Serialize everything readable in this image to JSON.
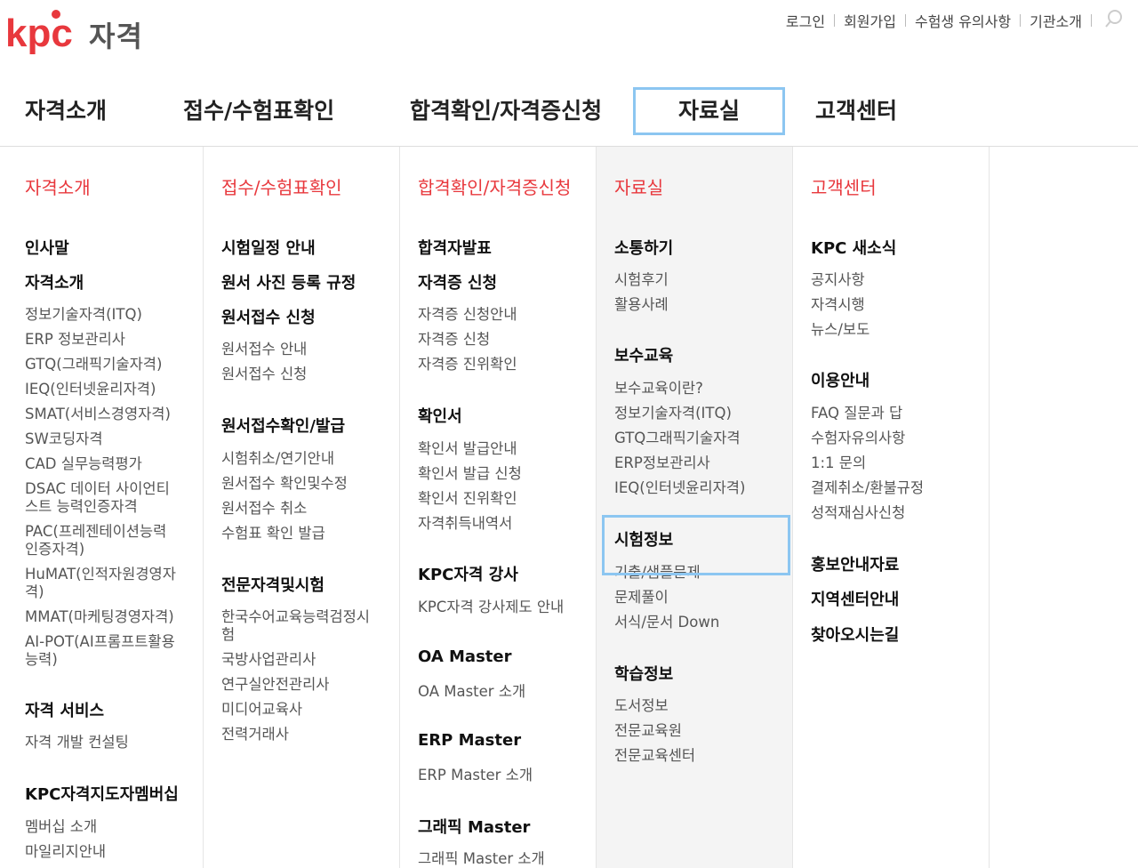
{
  "brand": {
    "logo_text": "kpc",
    "suffix": "자격",
    "logo_color": "#e8383d"
  },
  "util": [
    "로그인",
    "회원가입",
    "수험생 유의사항",
    "기관소개"
  ],
  "gnb": [
    "자격소개",
    "접수/수험표확인",
    "합격확인/자격증신청",
    "자료실",
    "고객센터"
  ],
  "accent": "#e8383d",
  "highlight_color": "#8cc6f1",
  "columns": [
    {
      "title": "자격소개",
      "items": [
        {
          "t": "h",
          "text": "인사말"
        },
        {
          "t": "h",
          "text": "자격소개"
        },
        {
          "t": "s",
          "text": "정보기술자격(ITQ)"
        },
        {
          "t": "s",
          "text": "ERP 정보관리사"
        },
        {
          "t": "s",
          "text": "GTQ(그래픽기술자격)"
        },
        {
          "t": "s",
          "text": "IEQ(인터넷윤리자격)"
        },
        {
          "t": "s",
          "text": "SMAT(서비스경영자격)"
        },
        {
          "t": "s",
          "text": "SW코딩자격"
        },
        {
          "t": "s",
          "text": "CAD 실무능력평가"
        },
        {
          "t": "s",
          "text": "DSAC 데이터 사이언티"
        },
        {
          "t": "s",
          "text": "스트 능력인증자격"
        },
        {
          "t": "s",
          "text": "PAC(프레젠테이션능력"
        },
        {
          "t": "s",
          "text": "인증자격)"
        },
        {
          "t": "s",
          "text": "HuMAT(인적자원경영자"
        },
        {
          "t": "s",
          "text": "격)"
        },
        {
          "t": "s",
          "text": "MMAT(마케팅경영자격)"
        },
        {
          "t": "s",
          "text": "AI-POT(AI프롬프트활용"
        },
        {
          "t": "s",
          "text": "능력)"
        },
        {
          "t": "h",
          "text": "자격 서비스"
        },
        {
          "t": "s",
          "text": "자격 개발 컨설팅"
        },
        {
          "t": "h",
          "text": "KPC자격지도자멤버십"
        },
        {
          "t": "s",
          "text": "멤버십 소개"
        },
        {
          "t": "s",
          "text": "마일리지안내"
        }
      ]
    },
    {
      "title": "접수/수험표확인",
      "items": [
        {
          "t": "h",
          "text": "시험일정 안내"
        },
        {
          "t": "h",
          "text": "원서 사진 등록 규정"
        },
        {
          "t": "h",
          "text": "원서접수 신청"
        },
        {
          "t": "s",
          "text": "원서접수 안내"
        },
        {
          "t": "s",
          "text": "원서접수 신청"
        },
        {
          "t": "h",
          "text": "원서접수확인/발급"
        },
        {
          "t": "s",
          "text": "시험취소/연기안내"
        },
        {
          "t": "s",
          "text": "원서접수 확인및수정"
        },
        {
          "t": "s",
          "text": "원서접수 취소"
        },
        {
          "t": "s",
          "text": "수험표 확인 발급"
        },
        {
          "t": "h",
          "text": "전문자격및시험"
        },
        {
          "t": "s",
          "text": "한국수어교육능력검정시"
        },
        {
          "t": "s",
          "text": "험"
        },
        {
          "t": "s",
          "text": "국방사업관리사"
        },
        {
          "t": "s",
          "text": "연구실안전관리사"
        },
        {
          "t": "s",
          "text": "미디어교육사"
        },
        {
          "t": "s",
          "text": "전력거래사"
        }
      ]
    },
    {
      "title": "합격확인/자격증신청",
      "items": [
        {
          "t": "h",
          "text": "합격자발표"
        },
        {
          "t": "h",
          "text": "자격증 신청"
        },
        {
          "t": "s",
          "text": "자격증 신청안내"
        },
        {
          "t": "s",
          "text": "자격증 신청"
        },
        {
          "t": "s",
          "text": "자격증 진위확인"
        },
        {
          "t": "h",
          "text": "확인서"
        },
        {
          "t": "s",
          "text": "확인서 발급안내"
        },
        {
          "t": "s",
          "text": "확인서 발급 신청"
        },
        {
          "t": "s",
          "text": "확인서 진위확인"
        },
        {
          "t": "s",
          "text": "자격취득내역서"
        },
        {
          "t": "h",
          "text": "KPC자격 강사"
        },
        {
          "t": "s",
          "text": "KPC자격 강사제도 안내"
        },
        {
          "t": "h",
          "text": "OA Master"
        },
        {
          "t": "s",
          "text": "OA Master 소개"
        },
        {
          "t": "h",
          "text": "ERP Master"
        },
        {
          "t": "s",
          "text": "ERP Master 소개"
        },
        {
          "t": "h",
          "text": "그래픽 Master"
        },
        {
          "t": "s",
          "text": "그래픽 Master 소개"
        }
      ]
    },
    {
      "title": "자료실",
      "items": [
        {
          "t": "h",
          "text": "소통하기"
        },
        {
          "t": "s",
          "text": "시험후기"
        },
        {
          "t": "s",
          "text": "활용사례"
        },
        {
          "t": "h",
          "text": "보수교육"
        },
        {
          "t": "s",
          "text": "보수교육이란?"
        },
        {
          "t": "s",
          "text": "정보기술자격(ITQ)"
        },
        {
          "t": "s",
          "text": "GTQ그래픽기술자격"
        },
        {
          "t": "s",
          "text": "ERP정보관리사"
        },
        {
          "t": "s",
          "text": "IEQ(인터넷윤리자격)"
        },
        {
          "t": "h",
          "text": "시험정보"
        },
        {
          "t": "s",
          "text": "기출/샘플문제"
        },
        {
          "t": "s",
          "text": "문제풀이"
        },
        {
          "t": "s",
          "text": "서식/문서 Down"
        },
        {
          "t": "h",
          "text": "학습정보"
        },
        {
          "t": "s",
          "text": "도서정보"
        },
        {
          "t": "s",
          "text": "전문교육원"
        },
        {
          "t": "s",
          "text": "전문교육센터"
        }
      ]
    },
    {
      "title": "고객센터",
      "items": [
        {
          "t": "h",
          "text": "KPC 새소식"
        },
        {
          "t": "s",
          "text": "공지사항"
        },
        {
          "t": "s",
          "text": "자격시행"
        },
        {
          "t": "s",
          "text": "뉴스/보도"
        },
        {
          "t": "h",
          "text": "이용안내"
        },
        {
          "t": "s",
          "text": "FAQ 질문과 답"
        },
        {
          "t": "s",
          "text": "수험자유의사항"
        },
        {
          "t": "s",
          "text": "1:1 문의"
        },
        {
          "t": "s",
          "text": "결제취소/환불규정"
        },
        {
          "t": "s",
          "text": "성적재심사신청"
        },
        {
          "t": "h",
          "text": "홍보안내자료"
        },
        {
          "t": "h",
          "text": "지역센터안내"
        },
        {
          "t": "h",
          "text": "찾아오시는길"
        }
      ]
    }
  ]
}
